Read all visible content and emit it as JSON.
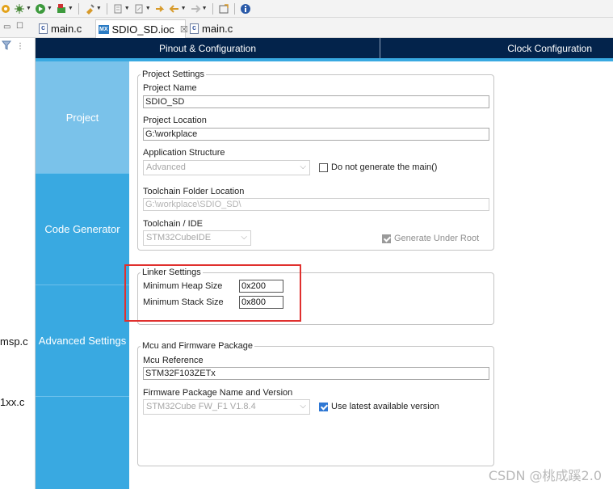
{
  "toolbar": {
    "icons": [
      "settings-icon",
      "debug-icon",
      "run-icon",
      "external-tools-icon",
      "pin-icon",
      "next-annotation-icon",
      "prev-annotation-icon",
      "last-edit-icon",
      "back-icon",
      "forward-icon",
      "open-perspective-icon",
      "info-icon"
    ]
  },
  "editor_tabs": [
    {
      "label": "main.c"
    },
    {
      "label": "SDIO_SD.ioc",
      "close": "☒"
    },
    {
      "label": "main.c"
    }
  ],
  "tab_badge": "MX",
  "left_strip": {
    "partial_items": [
      "msp.c",
      "1xx.c"
    ]
  },
  "header": {
    "pinout_tab": "Pinout & Configuration",
    "clock_tab": "Clock Configuration"
  },
  "categories": {
    "project": "Project",
    "code_generator": "Code Generator",
    "advanced_settings": "Advanced Settings"
  },
  "project_settings": {
    "title": "Project Settings",
    "project_name_label": "Project Name",
    "project_name": "SDIO_SD",
    "project_location_label": "Project Location",
    "project_location": "G:\\workplace",
    "app_structure_label": "Application Structure",
    "app_structure": "Advanced",
    "no_main_label": "Do not generate the main()",
    "toolchain_folder_label": "Toolchain Folder Location",
    "toolchain_folder": "G:\\workplace\\SDIO_SD\\",
    "toolchain_ide_label": "Toolchain / IDE",
    "toolchain_ide": "STM32CubeIDE",
    "generate_under_root_label": "Generate Under Root"
  },
  "linker_settings": {
    "title": "Linker Settings",
    "heap_label": "Minimum Heap Size",
    "heap_value": "0x200",
    "stack_label": "Minimum Stack Size",
    "stack_value": "0x800"
  },
  "mcu_package": {
    "title": "Mcu and Firmware Package",
    "mcu_ref_label": "Mcu Reference",
    "mcu_ref": "STM32F103ZETx",
    "fw_label": "Firmware Package Name and Version",
    "fw_value": "STM32Cube FW_F1 V1.8.4",
    "use_latest_label": "Use latest available version"
  },
  "watermark": "CSDN @桃成蹊2.0",
  "colors": {
    "header_bg": "#03234b",
    "accent": "#39a9e1",
    "category_selected": "#7ac2ea",
    "highlight": "#e0302e"
  }
}
